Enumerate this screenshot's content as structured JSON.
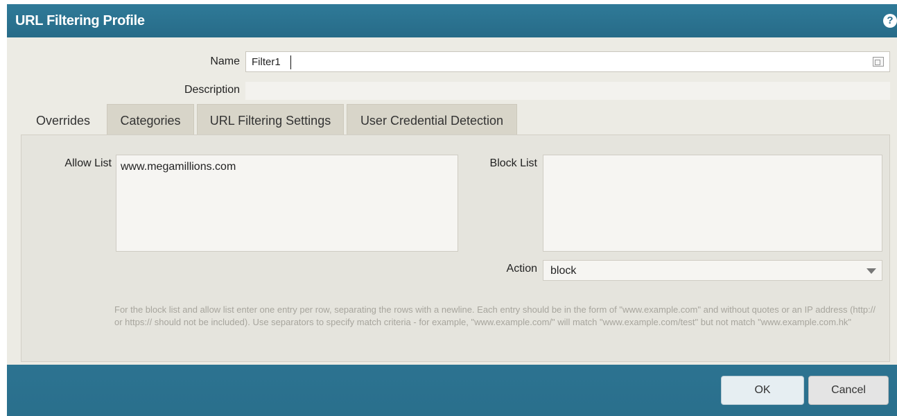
{
  "dialog": {
    "title": "URL Filtering Profile",
    "help_icon": "?"
  },
  "form": {
    "name_label": "Name",
    "name_value": "Filter1",
    "description_label": "Description",
    "description_value": ""
  },
  "tabs": [
    {
      "label": "Overrides",
      "active": true
    },
    {
      "label": "Categories",
      "active": false
    },
    {
      "label": "URL Filtering Settings",
      "active": false
    },
    {
      "label": "User Credential Detection",
      "active": false
    }
  ],
  "overrides": {
    "allow_list_label": "Allow List",
    "allow_list_entries": [
      "www.megamillions.com"
    ],
    "block_list_label": "Block List",
    "block_list_entries": [],
    "action_label": "Action",
    "action_value": "block",
    "help_text": "For the block list and allow list enter one entry per row, separating the rows with a newline. Each entry should be in the form of \"www.example.com\" and without quotes or an IP address (http:// or https:// should not be included). Use separators to specify match criteria - for example, \"www.example.com/\" will match \"www.example.com/test\" but not match \"www.example.com.hk\""
  },
  "buttons": {
    "ok": "OK",
    "cancel": "Cancel"
  },
  "icons": {
    "help": "help-icon",
    "field_edit": "field-edit-icon",
    "dropdown": "chevron-down-icon"
  },
  "colors": {
    "header": "#2a7090",
    "content_bg": "#ecebe4"
  }
}
